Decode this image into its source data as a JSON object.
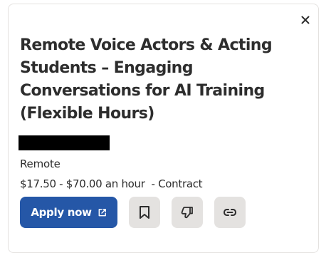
{
  "job": {
    "title": "Remote Voice Actors & Acting Students – Engaging Conversations for AI Training (Flexible Hours)",
    "location": "Remote",
    "salary": "$17.50 - $70.00 an hour  - Contract"
  },
  "actions": {
    "apply_label": "Apply now",
    "apply_icon": "external-link-icon",
    "save_icon": "bookmark-icon",
    "dislike_icon": "thumbs-down-icon",
    "copy_link_icon": "link-icon",
    "close_icon": "close-icon"
  },
  "colors": {
    "primary": "#2557a7",
    "text": "#2d2d2d",
    "secondary_button_bg": "#e4e2e0"
  }
}
